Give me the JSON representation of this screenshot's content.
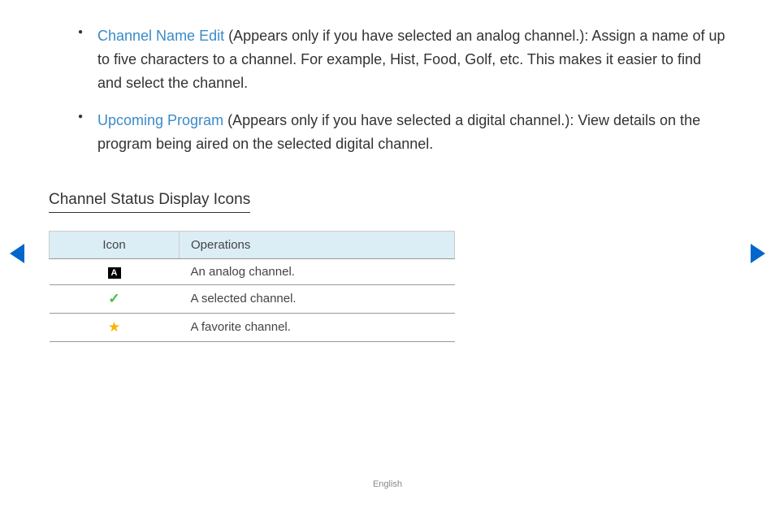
{
  "bullets": [
    {
      "title": "Channel Name Edit",
      "text": " (Appears only if you have selected an analog channel.): Assign a name of up to five characters to a channel. For example, Hist, Food, Golf, etc. This makes it easier to find and select the channel."
    },
    {
      "title": "Upcoming Program",
      "text": " (Appears only if you have selected a digital channel.): View details on the program being aired on the selected digital channel."
    }
  ],
  "section_title": "Channel Status Display Icons",
  "table": {
    "headers": {
      "icon": "Icon",
      "ops": "Operations"
    },
    "rows": [
      {
        "icon": "A",
        "ops": "An analog channel."
      },
      {
        "icon": "check",
        "ops": "A selected channel."
      },
      {
        "icon": "star",
        "ops": "A favorite channel."
      }
    ]
  },
  "icons": {
    "A": "A",
    "check": "✓",
    "star": "★"
  },
  "footer": "English"
}
